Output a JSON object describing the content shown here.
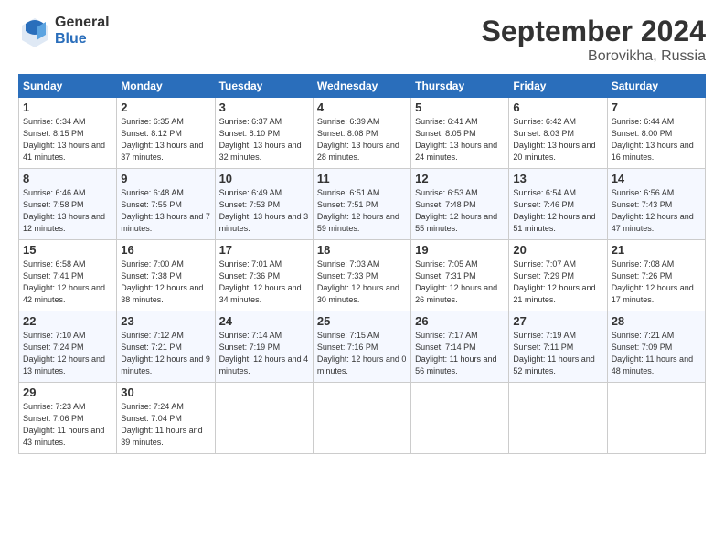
{
  "header": {
    "logo_general": "General",
    "logo_blue": "Blue",
    "month_title": "September 2024",
    "location": "Borovikha, Russia"
  },
  "days_of_week": [
    "Sunday",
    "Monday",
    "Tuesday",
    "Wednesday",
    "Thursday",
    "Friday",
    "Saturday"
  ],
  "weeks": [
    [
      {
        "num": "1",
        "sunrise": "6:34 AM",
        "sunset": "8:15 PM",
        "daylight": "13 hours and 41 minutes."
      },
      {
        "num": "2",
        "sunrise": "6:35 AM",
        "sunset": "8:12 PM",
        "daylight": "13 hours and 37 minutes."
      },
      {
        "num": "3",
        "sunrise": "6:37 AM",
        "sunset": "8:10 PM",
        "daylight": "13 hours and 32 minutes."
      },
      {
        "num": "4",
        "sunrise": "6:39 AM",
        "sunset": "8:08 PM",
        "daylight": "13 hours and 28 minutes."
      },
      {
        "num": "5",
        "sunrise": "6:41 AM",
        "sunset": "8:05 PM",
        "daylight": "13 hours and 24 minutes."
      },
      {
        "num": "6",
        "sunrise": "6:42 AM",
        "sunset": "8:03 PM",
        "daylight": "13 hours and 20 minutes."
      },
      {
        "num": "7",
        "sunrise": "6:44 AM",
        "sunset": "8:00 PM",
        "daylight": "13 hours and 16 minutes."
      }
    ],
    [
      {
        "num": "8",
        "sunrise": "6:46 AM",
        "sunset": "7:58 PM",
        "daylight": "13 hours and 12 minutes."
      },
      {
        "num": "9",
        "sunrise": "6:48 AM",
        "sunset": "7:55 PM",
        "daylight": "13 hours and 7 minutes."
      },
      {
        "num": "10",
        "sunrise": "6:49 AM",
        "sunset": "7:53 PM",
        "daylight": "13 hours and 3 minutes."
      },
      {
        "num": "11",
        "sunrise": "6:51 AM",
        "sunset": "7:51 PM",
        "daylight": "12 hours and 59 minutes."
      },
      {
        "num": "12",
        "sunrise": "6:53 AM",
        "sunset": "7:48 PM",
        "daylight": "12 hours and 55 minutes."
      },
      {
        "num": "13",
        "sunrise": "6:54 AM",
        "sunset": "7:46 PM",
        "daylight": "12 hours and 51 minutes."
      },
      {
        "num": "14",
        "sunrise": "6:56 AM",
        "sunset": "7:43 PM",
        "daylight": "12 hours and 47 minutes."
      }
    ],
    [
      {
        "num": "15",
        "sunrise": "6:58 AM",
        "sunset": "7:41 PM",
        "daylight": "12 hours and 42 minutes."
      },
      {
        "num": "16",
        "sunrise": "7:00 AM",
        "sunset": "7:38 PM",
        "daylight": "12 hours and 38 minutes."
      },
      {
        "num": "17",
        "sunrise": "7:01 AM",
        "sunset": "7:36 PM",
        "daylight": "12 hours and 34 minutes."
      },
      {
        "num": "18",
        "sunrise": "7:03 AM",
        "sunset": "7:33 PM",
        "daylight": "12 hours and 30 minutes."
      },
      {
        "num": "19",
        "sunrise": "7:05 AM",
        "sunset": "7:31 PM",
        "daylight": "12 hours and 26 minutes."
      },
      {
        "num": "20",
        "sunrise": "7:07 AM",
        "sunset": "7:29 PM",
        "daylight": "12 hours and 21 minutes."
      },
      {
        "num": "21",
        "sunrise": "7:08 AM",
        "sunset": "7:26 PM",
        "daylight": "12 hours and 17 minutes."
      }
    ],
    [
      {
        "num": "22",
        "sunrise": "7:10 AM",
        "sunset": "7:24 PM",
        "daylight": "12 hours and 13 minutes."
      },
      {
        "num": "23",
        "sunrise": "7:12 AM",
        "sunset": "7:21 PM",
        "daylight": "12 hours and 9 minutes."
      },
      {
        "num": "24",
        "sunrise": "7:14 AM",
        "sunset": "7:19 PM",
        "daylight": "12 hours and 4 minutes."
      },
      {
        "num": "25",
        "sunrise": "7:15 AM",
        "sunset": "7:16 PM",
        "daylight": "12 hours and 0 minutes."
      },
      {
        "num": "26",
        "sunrise": "7:17 AM",
        "sunset": "7:14 PM",
        "daylight": "11 hours and 56 minutes."
      },
      {
        "num": "27",
        "sunrise": "7:19 AM",
        "sunset": "7:11 PM",
        "daylight": "11 hours and 52 minutes."
      },
      {
        "num": "28",
        "sunrise": "7:21 AM",
        "sunset": "7:09 PM",
        "daylight": "11 hours and 48 minutes."
      }
    ],
    [
      {
        "num": "29",
        "sunrise": "7:23 AM",
        "sunset": "7:06 PM",
        "daylight": "11 hours and 43 minutes."
      },
      {
        "num": "30",
        "sunrise": "7:24 AM",
        "sunset": "7:04 PM",
        "daylight": "11 hours and 39 minutes."
      },
      null,
      null,
      null,
      null,
      null
    ]
  ]
}
